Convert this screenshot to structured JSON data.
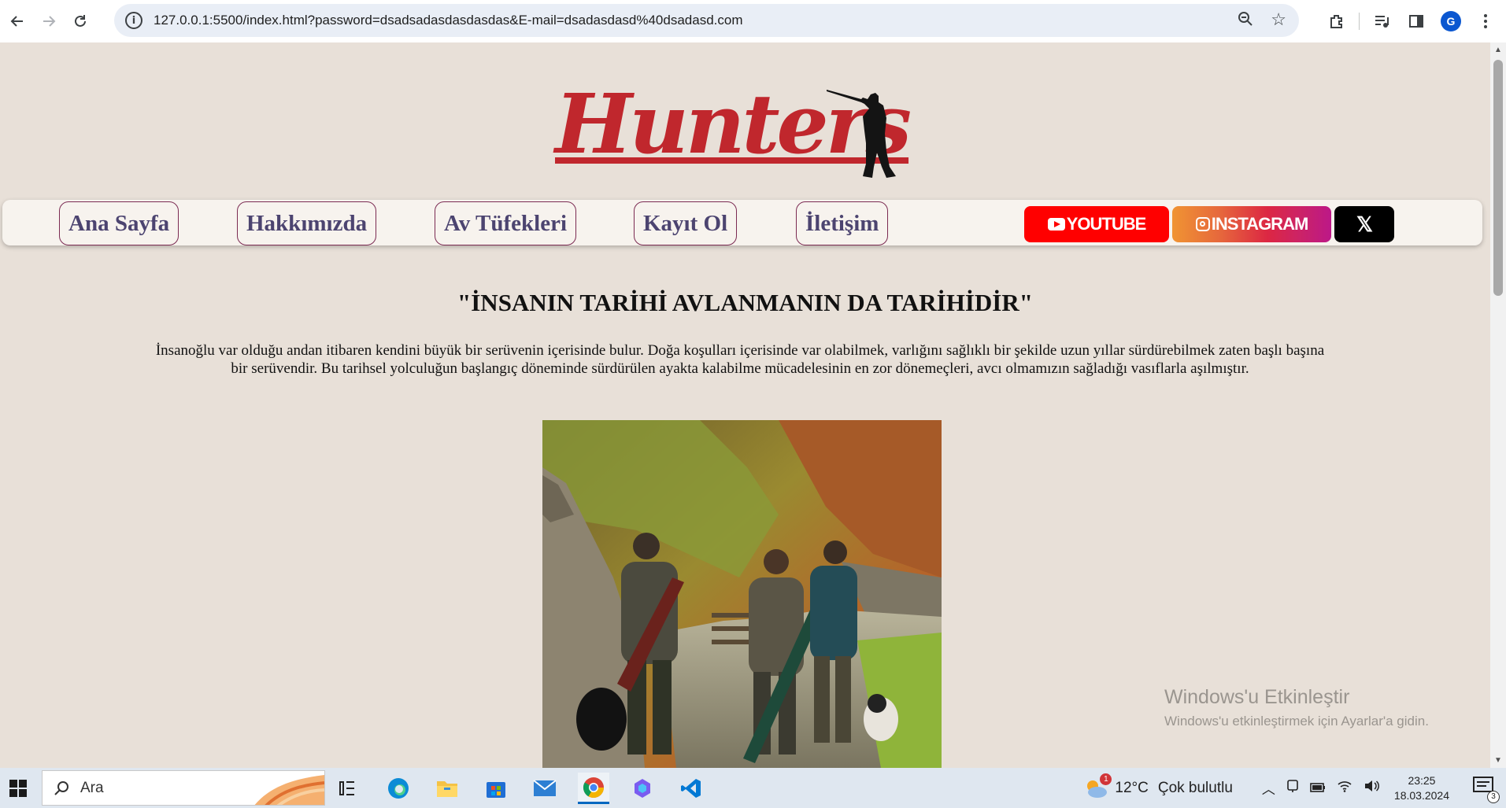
{
  "browser": {
    "url": "127.0.0.1:5500/index.html?password=dsadsadasdasdasdas&E-mail=dsadasdasd%40dsadasd.com",
    "profile_initial": "G"
  },
  "site": {
    "logo_text": "Hunters",
    "nav_links": [
      "Ana Sayfa",
      "Hakkımızda",
      "Av Tüfekleri",
      "Kayıt Ol",
      "İletişim"
    ],
    "social": {
      "youtube": "YOUTUBE",
      "instagram": "INSTAGRAM",
      "x": "𝕏"
    },
    "headline": "\"İNSANIN TARİHİ AVLANMANIN DA TARİHİDİR\"",
    "paragraph": "İnsanoğlu var olduğu andan itibaren kendini büyük bir serüvenin içerisinde bulur. Doğa koşulları içerisinde var olabilmek, varlığını sağlıklı bir şekilde uzun yıllar sürdürebilmek zaten başlı başına bir serüvendir. Bu tarihsel yolculuğun başlangıç döneminde sürdürülen ayakta kalabilme mücadelesinin en zor dönemeçleri, avcı olmamızın sağladığı vasıflarla aşılmıştır."
  },
  "watermark": {
    "title": "Windows'u Etkinleştir",
    "subtitle": "Windows'u etkinleştirmek için Ayarlar'a gidin."
  },
  "taskbar": {
    "search_placeholder": "Ara",
    "weather_temp": "12°C",
    "weather_desc": "Çok bulutlu",
    "weather_badge": "1",
    "time": "23:25",
    "date": "18.03.2024",
    "notification_count": "3"
  },
  "colors": {
    "page_bg": "#e8e0d8",
    "logo_red": "#c0272d",
    "nav_text": "#4c4470",
    "nav_border": "#7b2a52",
    "youtube": "#ff0000"
  }
}
